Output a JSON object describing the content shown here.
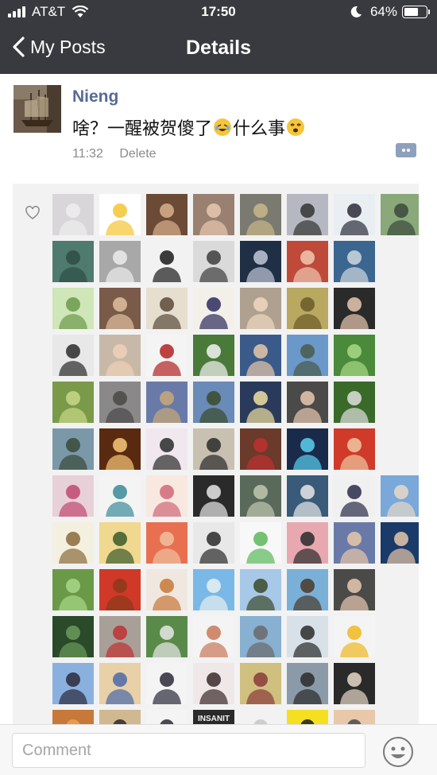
{
  "status_bar": {
    "carrier": "AT&T",
    "time": "17:50",
    "battery": "64%",
    "battery_level": 0.64,
    "icons": [
      "signal-icon",
      "wifi-icon",
      "moon-icon",
      "battery-icon"
    ]
  },
  "nav": {
    "back_label": "My Posts",
    "title": "Details"
  },
  "post": {
    "author": "Nieng",
    "text_before": "啥？一醒被贺傻了",
    "text_middle": "什么事",
    "time": "11:32",
    "delete_label": "Delete"
  },
  "likes": {
    "icon": "heart-icon",
    "avatars": [
      {
        "bg": "#d9d6da",
        "fg": "#eeeeee",
        "icon": "snow-landscape"
      },
      {
        "bg": "#ffffff",
        "fg": "#f3c432",
        "icon": "minion-cartoon"
      },
      {
        "bg": "#6b4a36",
        "fg": "#d9b08c",
        "icon": "person-photo"
      },
      {
        "bg": "#9a8070",
        "fg": "#e8c8b0",
        "icon": "baby-photo"
      },
      {
        "bg": "#7a7a70",
        "fg": "#c8b888",
        "icon": "tree-photo"
      },
      {
        "bg": "#b5b8c0",
        "fg": "#333333",
        "icon": "moon-sky"
      },
      {
        "bg": "#e8eef2",
        "fg": "#2c2c3a",
        "icon": "anime-character"
      },
      {
        "bg": "#8aa87a",
        "fg": "#3a4a3a",
        "icon": "person-field"
      },
      {
        "bg": "#4f7a6e",
        "fg": "#2d4e44",
        "icon": "lake-mountain"
      },
      {
        "bg": "#a8a8a8",
        "fg": "#ececec",
        "icon": "abstract-gray"
      },
      {
        "bg": "#f2f2f2",
        "fg": "#1b1b1b",
        "icon": "glasses-avatar"
      },
      {
        "bg": "#dadada",
        "fg": "#3d3d3d",
        "icon": "person-bw"
      },
      {
        "bg": "#1f2f45",
        "fg": "#c0c8d8",
        "icon": "star-shape"
      },
      {
        "bg": "#c04a3a",
        "fg": "#f0c8b0",
        "icon": "woman-portrait"
      },
      {
        "bg": "#3b6690",
        "fg": "#d0d8e0",
        "icon": "boat-photo"
      },
      {
        "bg": "#f2f2f2",
        "fg": "#ffffff",
        "icon": "blank"
      },
      {
        "bg": "#cfe6b8",
        "fg": "#6b9a4a",
        "icon": "cartoon-dragon"
      },
      {
        "bg": "#7a5a48",
        "fg": "#e0c0a0",
        "icon": "family-photo"
      },
      {
        "bg": "#e6dfcf",
        "fg": "#5a4a3a",
        "icon": "ink-drawing"
      },
      {
        "bg": "#f2f0e8",
        "fg": "#2e2a5e",
        "icon": "feather-wing"
      },
      {
        "bg": "#b0a090",
        "fg": "#f0d8c0",
        "icon": "child-stairs"
      },
      {
        "bg": "#b8a860",
        "fg": "#6b5a2a",
        "icon": "monkey-photo"
      },
      {
        "bg": "#2a2a2a",
        "fg": "#e8c8b0",
        "icon": "man-tuxedo"
      },
      {
        "bg": "#f2f2f2",
        "fg": "#ffffff",
        "icon": "blank"
      },
      {
        "bg": "#e8e8e8",
        "fg": "#2a2a2a",
        "icon": "man-portrait"
      },
      {
        "bg": "#c8b8a8",
        "fg": "#f0d0b8",
        "icon": "child-face"
      },
      {
        "bg": "#f4f4f4",
        "fg": "#b22222",
        "icon": "pliers-drawing"
      },
      {
        "bg": "#4a7a3a",
        "fg": "#f4f4f4",
        "icon": "panda-photo"
      },
      {
        "bg": "#3a5a8a",
        "fg": "#e8c8a8",
        "icon": "man-face"
      },
      {
        "bg": "#6a98c8",
        "fg": "#4a5a4a",
        "icon": "house-lake"
      },
      {
        "bg": "#4a8a3a",
        "fg": "#a8d888",
        "icon": "tree-garden"
      },
      {
        "bg": "#f2f2f2",
        "fg": "#ffffff",
        "icon": "blank"
      },
      {
        "bg": "#7a9a4a",
        "fg": "#c8d888",
        "icon": "trees-sunlight"
      },
      {
        "bg": "#8a8888",
        "fg": "#4a4848",
        "icon": "cat-photo"
      },
      {
        "bg": "#6a7aa8",
        "fg": "#c8a878",
        "icon": "castle-building"
      },
      {
        "bg": "#6a8ab8",
        "fg": "#3a4a2a",
        "icon": "mountain-person"
      },
      {
        "bg": "#2a3a5a",
        "fg": "#f0e0a0",
        "icon": "sunset-silhouette"
      },
      {
        "bg": "#4a4a48",
        "fg": "#e8c8b0",
        "icon": "man-suit"
      },
      {
        "bg": "#3a6a2a",
        "fg": "#e0e0e0",
        "icon": "people-field"
      },
      {
        "bg": "#f2f2f2",
        "fg": "#ffffff",
        "icon": "blank"
      },
      {
        "bg": "#7a98a8",
        "fg": "#3a4a3a",
        "icon": "river-path"
      },
      {
        "bg": "#5a2a10",
        "fg": "#f8c878",
        "icon": "light-glow"
      },
      {
        "bg": "#f0e8ee",
        "fg": "#2a2a2a",
        "icon": "anime-girl"
      },
      {
        "bg": "#c8c0b0",
        "fg": "#2a2a2a",
        "icon": "woman-standing"
      },
      {
        "bg": "#6a3a2a",
        "fg": "#c03030",
        "icon": "person-car"
      },
      {
        "bg": "#1a2a4a",
        "fg": "#5ad0f0",
        "icon": "wave-oscilloscope"
      },
      {
        "bg": "#d03a2a",
        "fg": "#f0c8a0",
        "icon": "man-red-shirt"
      },
      {
        "bg": "#f2f2f2",
        "fg": "#ffffff",
        "icon": "blank"
      },
      {
        "bg": "#e8d0d8",
        "fg": "#c04870",
        "icon": "girl-drawing"
      },
      {
        "bg": "#f4f4f4",
        "fg": "#3a8a9a",
        "icon": "pattern-chart"
      },
      {
        "bg": "#f8e8e0",
        "fg": "#d06878",
        "icon": "anime-hood"
      },
      {
        "bg": "#2a2a2a",
        "fg": "#e8e8e8",
        "icon": "lace-pattern"
      },
      {
        "bg": "#5a6a5a",
        "fg": "#c0c8b0",
        "icon": "garden-statue"
      },
      {
        "bg": "#3a5a7a",
        "fg": "#e8e8e8",
        "icon": "presenter-screen"
      },
      {
        "bg": "#f0f0f0",
        "fg": "#2a2a4a",
        "icon": "man-standing"
      },
      {
        "bg": "#7aa8d8",
        "fg": "#e8d8c8",
        "icon": "city-skyline"
      },
      {
        "bg": "#f4f0e0",
        "fg": "#8a6a3a",
        "icon": "owls-drawing"
      },
      {
        "bg": "#f0d890",
        "fg": "#3a5a2a",
        "icon": "sun-park"
      },
      {
        "bg": "#e87050",
        "fg": "#f0c0a0",
        "icon": "woman-dress"
      },
      {
        "bg": "#e8e8e8",
        "fg": "#2a2a2a",
        "icon": "woman-bw"
      },
      {
        "bg": "#f8f8f8",
        "fg": "#5ab85a",
        "icon": "green-cartoon"
      },
      {
        "bg": "#e8a8b0",
        "fg": "#2a2a2a",
        "icon": "girl-glasses"
      },
      {
        "bg": "#6a7aa8",
        "fg": "#e8c8a8",
        "icon": "family-group"
      },
      {
        "bg": "#1a3a6a",
        "fg": "#e8c8a8",
        "icon": "man-shirt"
      },
      {
        "bg": "#6a9a48",
        "fg": "#a8d888",
        "icon": "trees-path"
      },
      {
        "bg": "#d03828",
        "fg": "#8a3a1a",
        "icon": "monkey-toy"
      },
      {
        "bg": "#f0e8e0",
        "fg": "#c87838",
        "icon": "roast-food"
      },
      {
        "bg": "#7ab8e8",
        "fg": "#e8f0f0",
        "icon": "tower-building"
      },
      {
        "bg": "#a8c8e8",
        "fg": "#3a4a2a",
        "icon": "palm-trees"
      },
      {
        "bg": "#7ab0d8",
        "fg": "#4a3a2a",
        "icon": "person-seaside"
      },
      {
        "bg": "#4a4a48",
        "fg": "#e8c8b0",
        "icon": "man-glasses"
      },
      {
        "bg": "#f2f2f2",
        "fg": "#ffffff",
        "icon": "blank"
      },
      {
        "bg": "#2a4a2a",
        "fg": "#6a9a5a",
        "icon": "forest-aerial"
      },
      {
        "bg": "#a8a098",
        "fg": "#c03030",
        "icon": "people-bikes"
      },
      {
        "bg": "#5a8a4a",
        "fg": "#e8e8e8",
        "icon": "man-garden"
      },
      {
        "bg": "#f4f4f4",
        "fg": "#c87858",
        "icon": "cartoon-boy"
      },
      {
        "bg": "#88b0d0",
        "fg": "#6a6a6a",
        "icon": "fountain-building"
      },
      {
        "bg": "#d8e0e8",
        "fg": "#2a2a2a",
        "icon": "couple-photo"
      },
      {
        "bg": "#f4f4f4",
        "fg": "#f0b820",
        "icon": "chicken-toy"
      },
      {
        "bg": "#f2f2f2",
        "fg": "#ffffff",
        "icon": "blank"
      },
      {
        "bg": "#8ab0e0",
        "fg": "#2a2a3a",
        "icon": "person-lake"
      },
      {
        "bg": "#e8d0a8",
        "fg": "#4a6aa8",
        "icon": "beach-scene"
      },
      {
        "bg": "#f4f4f4",
        "fg": "#2a2a3a",
        "icon": "man-cap"
      },
      {
        "bg": "#f0e8e8",
        "fg": "#3a2a2a",
        "icon": "couple-selfie"
      },
      {
        "bg": "#d0c080",
        "fg": "#8a3a3a",
        "icon": "brain-drawing"
      },
      {
        "bg": "#8a9aa8",
        "fg": "#2a2a2a",
        "icon": "couple-beach"
      },
      {
        "bg": "#2a2a2a",
        "fg": "#e8d8c8",
        "icon": "night-lights"
      },
      {
        "bg": "#f2f2f2",
        "fg": "#ffffff",
        "icon": "blank"
      },
      {
        "bg": "#c87838",
        "fg": "#f0a050",
        "icon": "sunset-partial"
      },
      {
        "bg": "#d0b890",
        "fg": "#2a2a2a",
        "icon": "people-partial"
      },
      {
        "bg": "#f4f4f4",
        "fg": "#2a2a3a",
        "icon": "group-partial"
      },
      {
        "bg": "#2a2a2a",
        "fg": "#f4f4f4",
        "icon": "insanity-logo"
      },
      {
        "bg": "#f2f2f2",
        "fg": "#c8c8c8",
        "icon": "dot-partial"
      },
      {
        "bg": "#f4e020",
        "fg": "#1a1a1a",
        "icon": "penguin-partial"
      },
      {
        "bg": "#e8c8a8",
        "fg": "#4a4a4a",
        "icon": "family-partial"
      },
      {
        "bg": "#f2f2f2",
        "fg": "#ffffff",
        "icon": "blank"
      }
    ],
    "logo_text": "INSANIT"
  },
  "comment_bar": {
    "placeholder": "Comment",
    "emoji_icon": "smile-face-icon"
  }
}
